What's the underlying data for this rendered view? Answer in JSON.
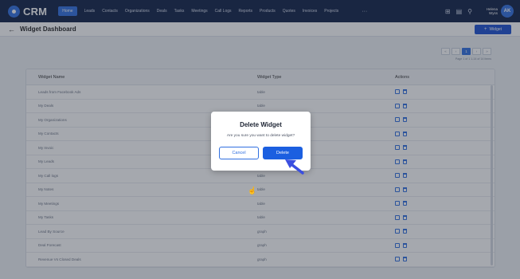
{
  "app": {
    "name": "CRM"
  },
  "nav": {
    "items": [
      "Home",
      "Leads",
      "Contacts",
      "Organizations",
      "Deals",
      "Tasks",
      "Meetings",
      "Call Logs",
      "Reports",
      "Products",
      "Quotes",
      "Invoices",
      "Projects"
    ],
    "active_index": 0,
    "more": "···"
  },
  "top_icons": {
    "apps": "⊞",
    "calendar": "▤",
    "search": "⚲"
  },
  "user": {
    "name_line1": "Helena",
    "name_line2": "Wyss",
    "initials": "AK"
  },
  "header": {
    "back": "←",
    "title": "Widget Dashboard",
    "add_button": "Widget",
    "add_plus": "+"
  },
  "pagination": {
    "first": "«",
    "prev": "‹",
    "current": "1",
    "next": "›",
    "last": "»",
    "info": "Page 1 of 1  1-14 of 14 items"
  },
  "table": {
    "headers": {
      "name": "Widget Name",
      "type": "Widget Type",
      "actions": "Actions"
    },
    "rows": [
      {
        "name": "Leads from Facebook Ads",
        "type": "table"
      },
      {
        "name": "My Deals",
        "type": "table"
      },
      {
        "name": "My Organizations",
        "type": ""
      },
      {
        "name": "My Contacts",
        "type": ""
      },
      {
        "name": "My Invoic",
        "type": ""
      },
      {
        "name": "My Leads",
        "type": ""
      },
      {
        "name": "My Call logs",
        "type": "table"
      },
      {
        "name": "My Notes",
        "type": "table"
      },
      {
        "name": "My Meetings",
        "type": "table"
      },
      {
        "name": "My Tasks",
        "type": "table"
      },
      {
        "name": "Lead By Source",
        "type": "graph"
      },
      {
        "name": "Deal Forecast",
        "type": "graph"
      },
      {
        "name": "Revenue Vs Closed Deals",
        "type": "graph"
      }
    ]
  },
  "modal": {
    "title": "Delete Widget",
    "message": "Are you sure you want to delete widget?",
    "cancel": "Cancel",
    "confirm": "Delete"
  },
  "colors": {
    "nav_bg": "#0f1f45",
    "accent": "#1b5fe0",
    "overlay": "rgba(40,48,62,0.42)"
  }
}
